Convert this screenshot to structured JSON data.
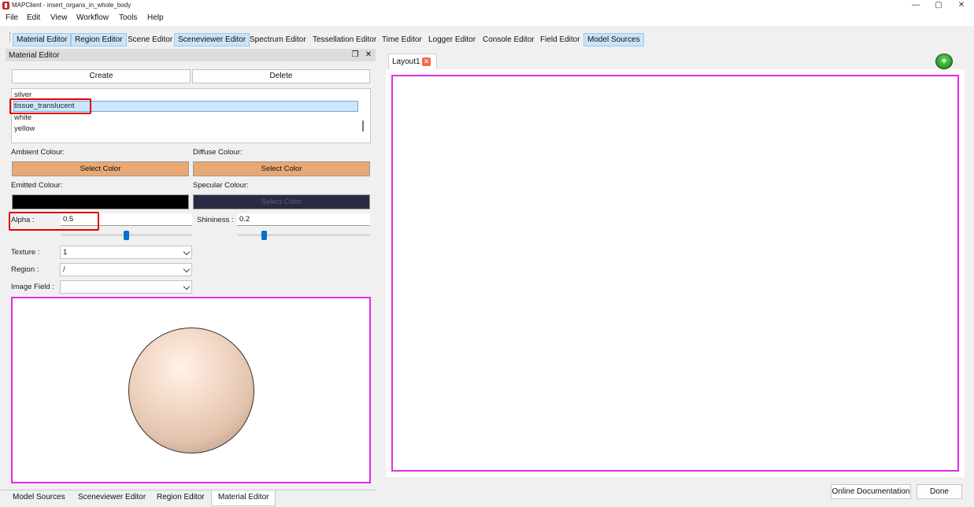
{
  "window": {
    "title": "MAPClient - insert_organs_in_whole_body",
    "controls": {
      "minimize": "—",
      "maximize": "▢",
      "close": "✕"
    }
  },
  "menu": [
    "File",
    "Edit",
    "View",
    "Workflow",
    "Tools",
    "Help"
  ],
  "toolbar": {
    "items": [
      "Material Editor",
      "Region Editor",
      "Scene Editor",
      "Sceneviewer Editor",
      "Spectrum Editor",
      "Tessellation Editor",
      "Time Editor",
      "Logger Editor",
      "Console Editor",
      "Field Editor",
      "Model Sources"
    ],
    "active": [
      "Material Editor",
      "Region Editor",
      "Sceneviewer Editor",
      "Model Sources"
    ]
  },
  "dock": {
    "title": "Material Editor",
    "float_icon": "restore-icon",
    "close_icon": "close-icon",
    "float_glyph": "❐",
    "close_glyph": "✕"
  },
  "material_editor": {
    "create_label": "Create",
    "delete_label": "Delete",
    "materials": [
      "silver",
      "tissue_translucent",
      "white",
      "yellow"
    ],
    "selected_material": "tissue_translucent",
    "ambient_label": "Ambient Colour:",
    "diffuse_label": "Diffuse Colour:",
    "emitted_label": "Emitted Colour:",
    "specular_label": "Specular Colour:",
    "select_color_label": "Select Color",
    "ambient_color": "#e8a874",
    "diffuse_color": "#e8a874",
    "emitted_color": "#000000",
    "specular_color": "#2a2a44",
    "alpha_label": "Alpha :",
    "alpha_value": "0.5",
    "alpha_fraction": 0.5,
    "shininess_label": "Shininess :",
    "shininess_value": "0.2",
    "shininess_fraction": 0.2,
    "texture_label": "Texture :",
    "texture_value": "1",
    "region_label": "Region :",
    "region_value": "/",
    "image_field_label": "Image Field :",
    "image_field_value": ""
  },
  "bottom_tabs": {
    "items": [
      "Model Sources",
      "Sceneviewer Editor",
      "Region Editor",
      "Material Editor"
    ],
    "active": "Material Editor"
  },
  "layout": {
    "tab_label": "Layout1",
    "close_glyph": "✕",
    "add_glyph": "+"
  },
  "footer": {
    "online_docs_label": "Online Documentation",
    "done_label": "Done"
  },
  "highlight_color": "#e00000",
  "accent_magenta": "#e32ce3"
}
